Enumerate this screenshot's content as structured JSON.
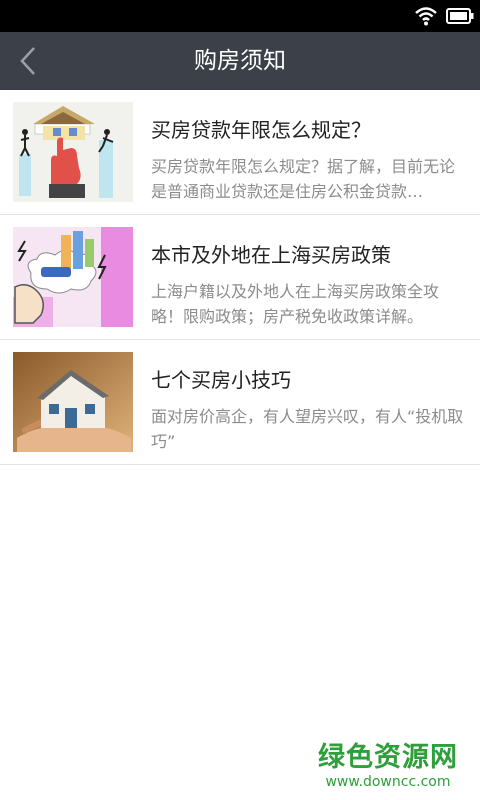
{
  "status_bar": {
    "icons": [
      "wifi-icon",
      "battery-icon"
    ]
  },
  "header": {
    "title": "购房须知",
    "back_icon": "chevron-left-icon"
  },
  "articles": [
    {
      "title": "买房贷款年限怎么规定？",
      "desc": "买房贷款年限怎么规定？据了解，目前无论是普通商业贷款还是住房公积金贷款…",
      "image": "house-loan-illustration"
    },
    {
      "title": "本市及外地在上海买房政策",
      "desc": "上海户籍以及外地人在上海买房政策全攻略！限购政策；房产税免收政策详解。",
      "image": "property-market-policy-illustration"
    },
    {
      "title": "七个买房小技巧",
      "desc": "面对房价高企，有人望房兴叹，有人“投机取巧”",
      "image": "house-in-hands-photo"
    }
  ],
  "watermark": {
    "main": "绿色资源网",
    "sub": "www.downcc.com"
  },
  "colors": {
    "header_bg": "#3b4049",
    "watermark": "#2e9f3a"
  }
}
